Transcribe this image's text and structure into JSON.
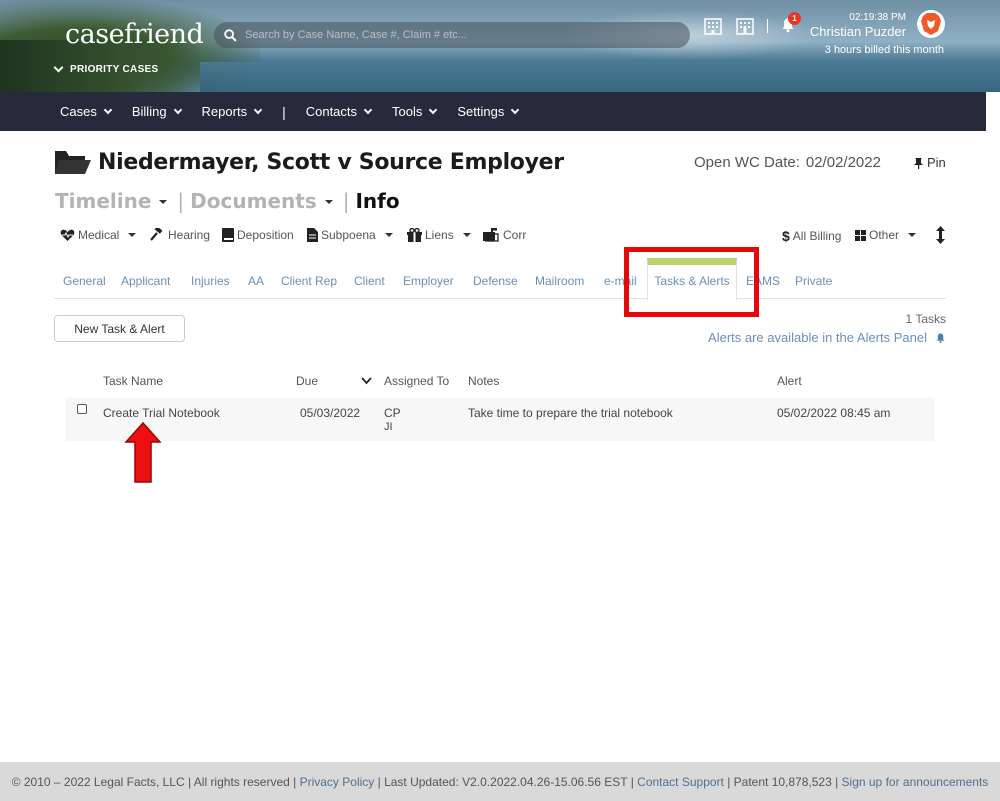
{
  "header": {
    "logo": "casefriend",
    "priority_label": "PRIORITY CASES",
    "search_placeholder": "Search by Case Name, Case #, Claim # etc...",
    "notification_count": "1",
    "time": "02:19:38 PM",
    "user_name": "Christian Puzder",
    "billed_text": "3 hours billed this month"
  },
  "nav": {
    "items": [
      "Cases",
      "Billing",
      "Reports",
      "Contacts",
      "Tools",
      "Settings"
    ],
    "separator": "|"
  },
  "case": {
    "title": "Niedermayer, Scott v Source Employer",
    "open_label": "Open WC Date:",
    "open_date": "02/02/2022",
    "pin_label": "Pin"
  },
  "subtabs": {
    "timeline": "Timeline",
    "documents": "Documents",
    "info": "Info",
    "bar": "|"
  },
  "tools": {
    "medical": "Medical",
    "hearing": "Hearing",
    "deposition": "Deposition",
    "subpoena": "Subpoena",
    "liens": "Liens",
    "corr": "Corr",
    "all_billing": "All Billing",
    "other": "Other"
  },
  "tabs": {
    "general": "General",
    "applicant": "Applicant",
    "injuries": "Injuries",
    "aa": "AA",
    "client_rep": "Client Rep",
    "client": "Client",
    "employer": "Employer",
    "defense": "Defense",
    "mailroom": "Mailroom",
    "email": "e-mail",
    "tasks_alerts": "Tasks & Alerts",
    "eams": "EAMS",
    "private": "Private"
  },
  "tasks": {
    "new_button": "New Task & Alert",
    "count": "1 Tasks",
    "alerts_note": "Alerts are available in the Alerts Panel",
    "columns": {
      "name": "Task Name",
      "due": "Due",
      "assigned": "Assigned To",
      "notes": "Notes",
      "alert": "Alert"
    },
    "rows": [
      {
        "name": "Create Trial Notebook",
        "due": "05/03/2022",
        "assigned_1": "CP",
        "assigned_2": "JI",
        "notes": "Take time to prepare the trial notebook",
        "alert": "05/02/2022 08:45 am"
      }
    ]
  },
  "footer": {
    "copyright": "© 2010 – 2022 Legal Facts, LLC | All rights reserved | ",
    "privacy": "Privacy Policy",
    "updated": " | Last Updated: V2.0.2022.04.26-15.06.56 EST | ",
    "support": "Contact Support",
    "patent": " | Patent 10,878,523 | ",
    "signup": "Sign up for announcements"
  },
  "colors": {
    "nav_bg": "#252b3a",
    "tab_link": "#6b8fb5",
    "active_tab_accent": "#b9d26b",
    "highlight_red": "#e40808",
    "footer_bg": "#d9d9d9"
  }
}
